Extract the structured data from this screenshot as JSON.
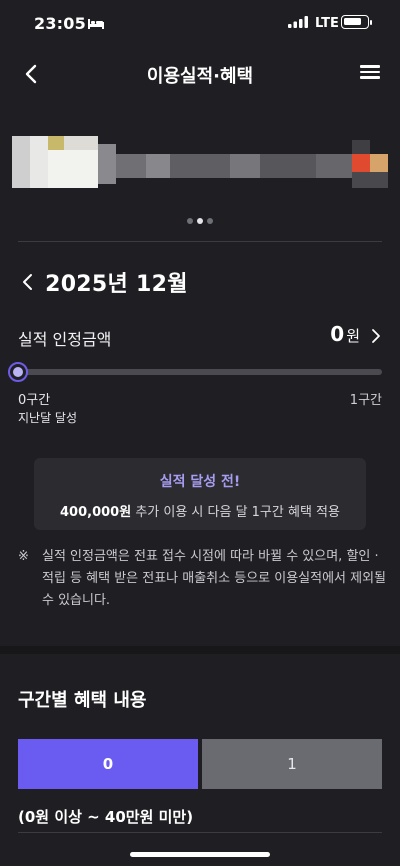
{
  "status_bar": {
    "time": "23:05",
    "network": "LTE",
    "icons": [
      "bed-icon",
      "signal-icon",
      "battery-icon"
    ]
  },
  "nav": {
    "title": "이용실적·혜택",
    "back_icon": "chevron-left-icon",
    "menu_icon": "hamburger-menu-icon"
  },
  "carousel": {
    "page_count": 3,
    "active_page": 2
  },
  "performance": {
    "month": "2025년 12월",
    "amount_label": "실적 인정금액",
    "amount_value": "0",
    "amount_unit": "원",
    "progress_fraction": 0,
    "tier_start": "0구간",
    "tier_start_sub": "지난달 달성",
    "tier_end": "1구간"
  },
  "notice": {
    "title": "실적 달성 전!",
    "amount": "400,000원",
    "desc": " 추가 이용 시 다음 달 1구간 혜택 적용"
  },
  "disclaimer": {
    "mark": "※",
    "text": "실적 인정금액은 전표 접수 시점에 따라 바뀔 수 있으며, 할인 · 적립 등 혜택 받은 전표나 매출취소 등으로 이용실적에서 제외될 수 있습니다."
  },
  "benefits": {
    "section_title": "구간별 혜택 내용",
    "tabs": [
      {
        "label": "0",
        "active": true
      },
      {
        "label": "1",
        "active": false
      }
    ],
    "range_label": "(0원 이상 ~ 40만원 미만)"
  },
  "colors": {
    "background": "#1f1f23",
    "accent": "#6a5cf0",
    "notice_title": "#a79df0"
  }
}
